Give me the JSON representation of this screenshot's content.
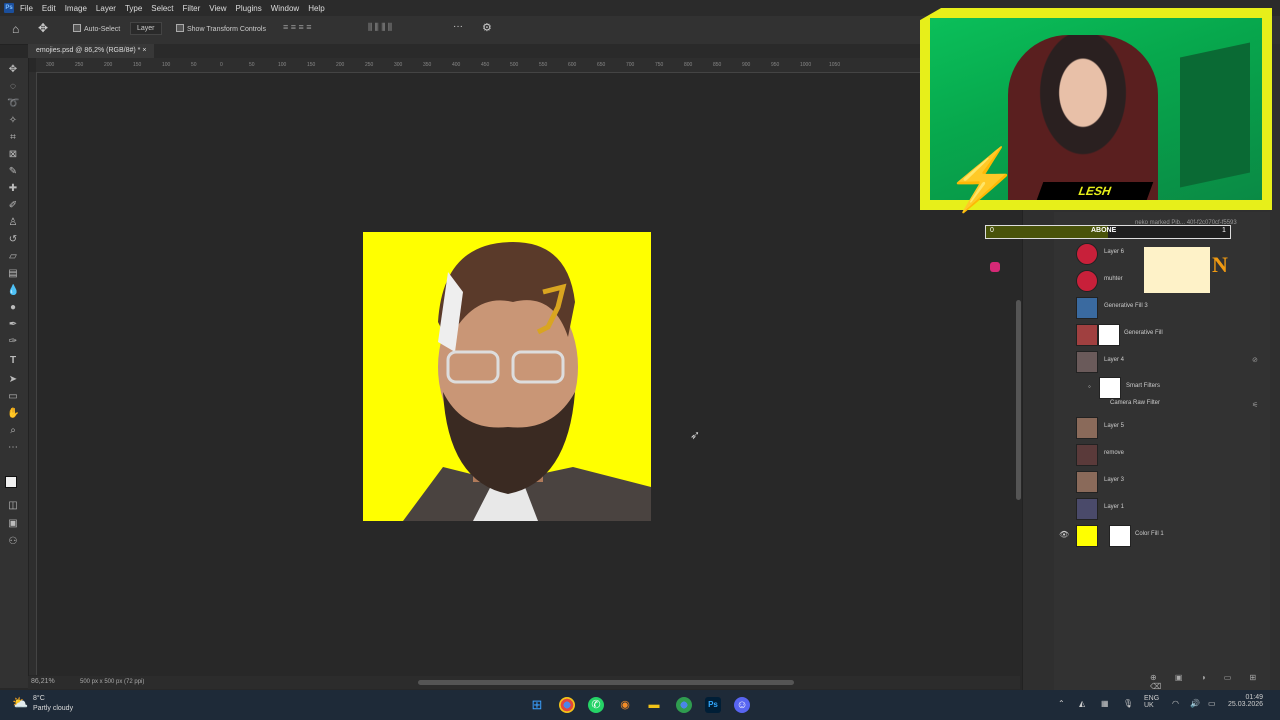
{
  "menu": [
    "File",
    "Edit",
    "Image",
    "Layer",
    "Type",
    "Select",
    "Filter",
    "View",
    "Plugins",
    "Window",
    "Help"
  ],
  "app_logo": "Ps",
  "options": {
    "auto_select_label": "Auto-Select",
    "auto_select_target": "Layer",
    "show_transform_label": "Show Transform Controls",
    "more": "···"
  },
  "document_tab": "emojies.psd @ 86,2% (RGB/8#) *",
  "ruler_ticks": [
    "300",
    "250",
    "200",
    "150",
    "100",
    "50",
    "0",
    "50",
    "100",
    "150",
    "200",
    "250",
    "300",
    "350",
    "400",
    "450",
    "500",
    "550",
    "600",
    "650",
    "700",
    "750",
    "800",
    "850",
    "900",
    "950",
    "1000",
    "1050"
  ],
  "status": {
    "zoom": "86,21%",
    "doc_info": "500 px x 500 px (72 ppi)"
  },
  "layers": [
    {
      "name": "Layer 6",
      "visible": false
    },
    {
      "name": "muhter",
      "visible": false
    },
    {
      "name": "Generative Fill 3",
      "visible": false
    },
    {
      "name": "Generative Fill",
      "visible": false
    },
    {
      "name": "Layer 4",
      "visible": false
    },
    {
      "name": "Smart Filters",
      "visible": false
    },
    {
      "name": "Camera Raw Filter",
      "visible": false
    },
    {
      "name": "Layer 5",
      "visible": false
    },
    {
      "name": "remove",
      "visible": false
    },
    {
      "name": "Layer 3",
      "visible": false
    },
    {
      "name": "Layer 1",
      "visible": false
    },
    {
      "name": "Color Fill 1",
      "visible": true
    }
  ],
  "layer_top_partial": "neko marked Pib... 40f-f2c070cf-f5593",
  "notes_letter": "N",
  "webcam": {
    "name": "LESH",
    "accent": "#e7ef1a",
    "bg": "#0bbf5a"
  },
  "subscribe": {
    "left": "0",
    "label": "ABONE",
    "right": "1",
    "progress": 0.5
  },
  "taskbar": {
    "weather_temp": "8°C",
    "weather_desc": "Partly cloudy",
    "lang1": "ENG",
    "lang2": "UK",
    "time": "01:49",
    "date": "25.03.2026"
  },
  "colors": {
    "canvas_bg": "#ffff00",
    "workspace": "#282828"
  }
}
